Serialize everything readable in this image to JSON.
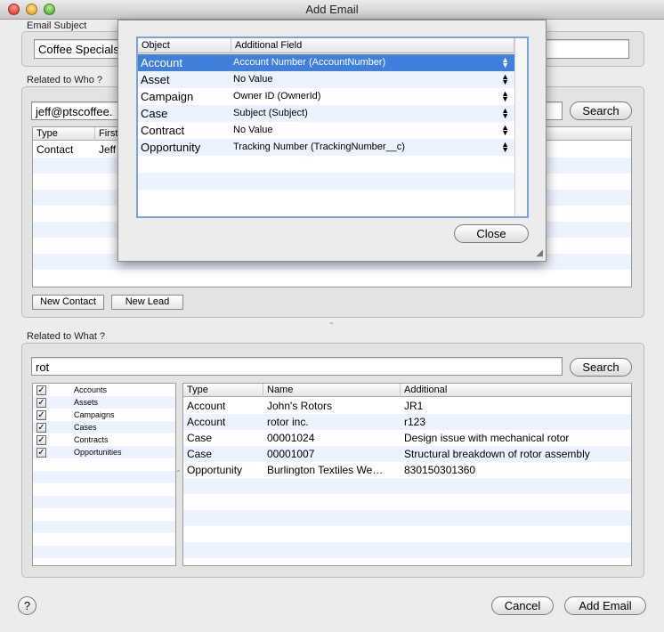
{
  "window": {
    "title": "Add Email"
  },
  "email_subject": {
    "label": "Email Subject",
    "value": "Coffee Specials"
  },
  "related_to_who": {
    "label": "Related to Who ?",
    "search_value": "jeff@ptscoffee.",
    "search_button": "Search",
    "columns": [
      "Type",
      "First"
    ],
    "rows": [
      {
        "type": "Contact",
        "first": "Jeff"
      }
    ],
    "new_contact_button": "New Contact",
    "new_lead_button": "New Lead"
  },
  "related_to_what": {
    "label": "Related to What ?",
    "search_value": "rot",
    "search_button": "Search",
    "filters": [
      {
        "label": "Accounts",
        "checked": true
      },
      {
        "label": "Assets",
        "checked": true
      },
      {
        "label": "Campaigns",
        "checked": true
      },
      {
        "label": "Cases",
        "checked": true
      },
      {
        "label": "Contracts",
        "checked": true
      },
      {
        "label": "Opportunities",
        "checked": true
      }
    ],
    "columns": [
      "Type",
      "Name",
      "Additional"
    ],
    "rows": [
      {
        "type": "Account",
        "name": "John's Rotors",
        "additional": "JR1"
      },
      {
        "type": "Account",
        "name": "rotor inc.",
        "additional": "r123"
      },
      {
        "type": "Case",
        "name": "00001024",
        "additional": "Design issue with mechanical rotor"
      },
      {
        "type": "Case",
        "name": "00001007",
        "additional": "Structural breakdown of rotor assembly"
      },
      {
        "type": "Opportunity",
        "name": "Burlington Textiles We…",
        "additional": "830150301360"
      }
    ]
  },
  "popup": {
    "columns": [
      "Object",
      "Additional Field"
    ],
    "rows": [
      {
        "object": "Account",
        "field": "Account Number (AccountNumber)",
        "selected": true
      },
      {
        "object": "Asset",
        "field": "No Value"
      },
      {
        "object": "Campaign",
        "field": "Owner ID (OwnerId)"
      },
      {
        "object": "Case",
        "field": "Subject (Subject)"
      },
      {
        "object": "Contract",
        "field": "No Value"
      },
      {
        "object": "Opportunity",
        "field": "Tracking Number (TrackingNumber__c)"
      }
    ],
    "close_button": "Close"
  },
  "footer": {
    "help_label": "?",
    "cancel_button": "Cancel",
    "add_button": "Add Email"
  },
  "icons": {
    "close": "close-icon",
    "minimize": "minimize-icon",
    "zoom": "zoom-icon",
    "check": "checkmark-icon",
    "stepper": "stepper-arrows-icon",
    "resize": "resize-grip-icon"
  },
  "colors": {
    "selection": "#3d80df",
    "row_stripe": "#edf3fe"
  }
}
